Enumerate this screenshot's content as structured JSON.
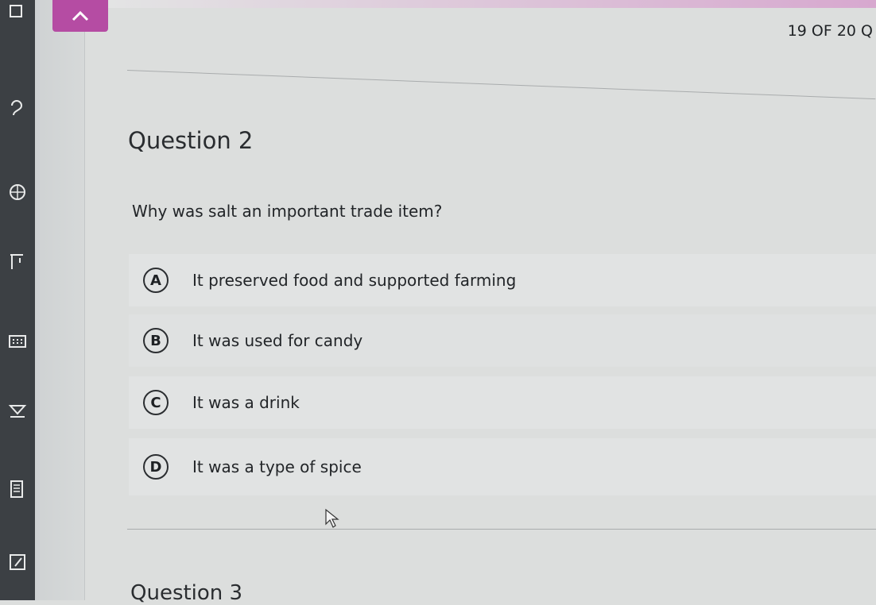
{
  "header": {
    "progress": "19 OF 20 Q"
  },
  "question": {
    "title": "Question 2",
    "text": "Why was salt an important trade item?",
    "options": [
      {
        "letter": "A",
        "label": "It preserved food and supported farming"
      },
      {
        "letter": "B",
        "label": "It was used for candy"
      },
      {
        "letter": "C",
        "label": "It was a drink"
      },
      {
        "letter": "D",
        "label": "It was a type of spice"
      }
    ]
  },
  "next_question": {
    "title": "Question 3"
  },
  "icons": {
    "collapse": "chevron-up-icon",
    "rail": [
      "hearing-icon",
      "translate-globe-icon",
      "line-reader-icon",
      "calculator-icon",
      "highlighter-icon",
      "notepad-icon",
      "flag-icon"
    ]
  },
  "colors": {
    "accent": "#b54ca3",
    "rail": "#3c4044",
    "background": "#dcdedd"
  }
}
